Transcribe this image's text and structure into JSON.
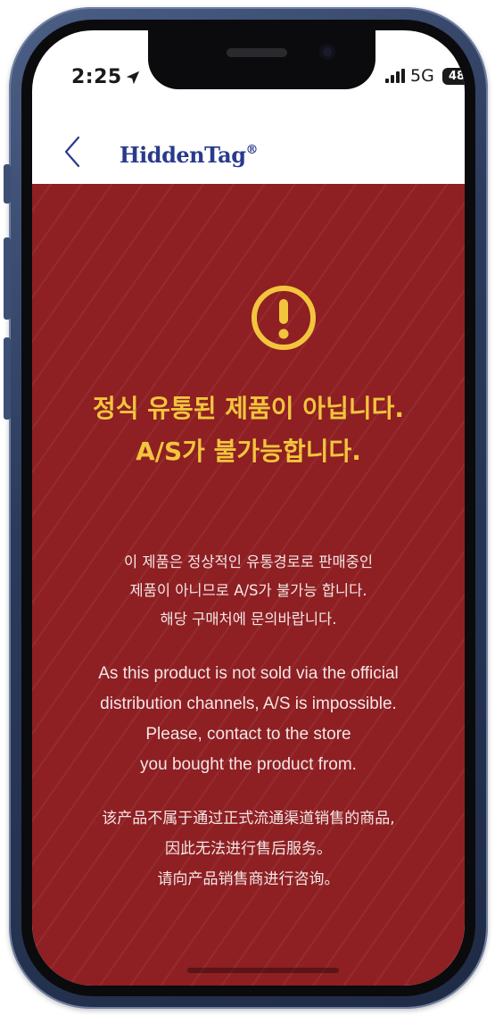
{
  "status_bar": {
    "time": "2:25",
    "location_icon": "location-arrow-icon",
    "signal_icon": "cellular-signal-icon",
    "network": "5G",
    "battery": "48"
  },
  "nav": {
    "back_icon": "chevron-left-icon",
    "logo_text": "HiddenTag",
    "logo_reg": "®"
  },
  "alert": {
    "icon": "exclamation-circle-icon",
    "headline_line1": "정식 유통된 제품이 아닙니다.",
    "headline_line2": "A/S가 불가능합니다.",
    "korean": [
      "이 제품은 정상적인 유통경로로 판매중인",
      "제품이 아니므로  A/S가 불가능 합니다.",
      "해당 구매처에 문의바랍니다."
    ],
    "english": [
      "As this product is not sold via the official",
      "distribution channels, A/S is impossible.",
      "Please, contact to the store",
      "you bought the product from."
    ],
    "chinese": [
      "该产品不属于通过正式流通渠道销售的商品,",
      "因此无法进行售后服务。",
      "请向产品销售商进行咨询。"
    ]
  },
  "colors": {
    "background": "#8e1f22",
    "accent": "#f2c53d",
    "body_text": "#f3e6e6",
    "logo": "#2a3a8c"
  }
}
